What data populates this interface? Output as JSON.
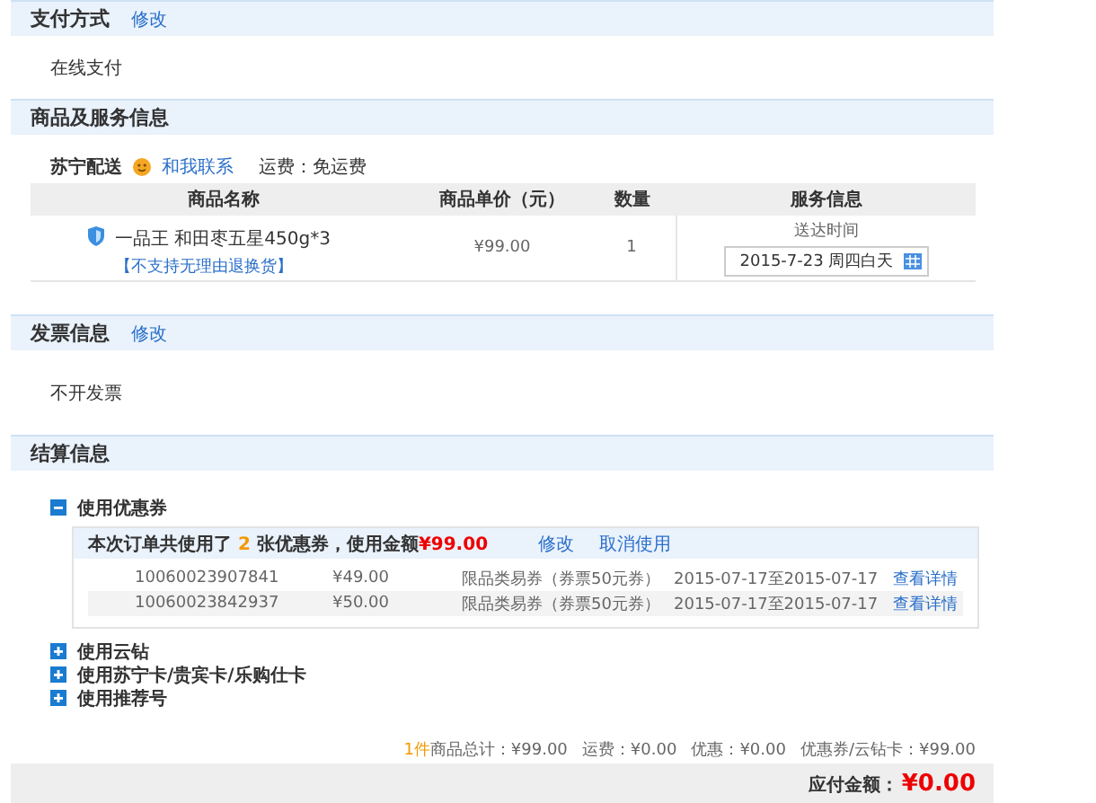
{
  "payment": {
    "title": "支付方式",
    "edit": "修改",
    "value": "在线支付"
  },
  "goods": {
    "title": "商品及服务信息",
    "shipper": "苏宁配送",
    "contact": "和我联系",
    "freight": "运费：免运费",
    "columns": [
      "商品名称",
      "商品单价（元）",
      "数量",
      "服务信息"
    ],
    "rows": [
      {
        "name": "一品王 和田枣五星450g*3",
        "note": "【不支持无理由退换货】",
        "price": "¥99.00",
        "quantity": "1",
        "service_label": "送达时间",
        "delivery_date": "2015-7-23 周四白天"
      }
    ]
  },
  "invoice": {
    "title": "发票信息",
    "edit": "修改",
    "value": "不开发票"
  },
  "settlement": {
    "title": "结算信息",
    "options": [
      {
        "label": "使用优惠券",
        "expanded": true,
        "summary": {
          "prefix": "本次订单共使用了",
          "count": "2",
          "middle": "张优惠券，使用金额",
          "amount": "¥99.00"
        },
        "edit": "修改",
        "cancel": "取消使用",
        "coupons": [
          {
            "code": "10060023907841",
            "amount": "¥49.00",
            "type": "限品类易券（券票50元券）",
            "validity": "2015-07-17至2015-07-17",
            "link": "查看详情"
          },
          {
            "code": "10060023842937",
            "amount": "¥50.00",
            "type": "限品类易券（券票50元券）",
            "validity": "2015-07-17至2015-07-17",
            "link": "查看详情"
          }
        ]
      },
      {
        "label": "使用云钻",
        "expanded": false
      },
      {
        "label": "使用苏宁卡/贵宾卡/乐购仕卡",
        "expanded": false
      },
      {
        "label": "使用推荐号",
        "expanded": false
      }
    ]
  },
  "totals": {
    "count": "1件",
    "items": [
      {
        "label": "商品总计：",
        "value": "¥99.00"
      },
      {
        "label": "运费：",
        "value": "¥0.00"
      },
      {
        "label": "优惠：",
        "value": "¥0.00"
      },
      {
        "label": "优惠券/云钻卡：",
        "value": "¥99.00"
      }
    ],
    "payable_label": "应付金额：",
    "payable": "¥0.00"
  }
}
